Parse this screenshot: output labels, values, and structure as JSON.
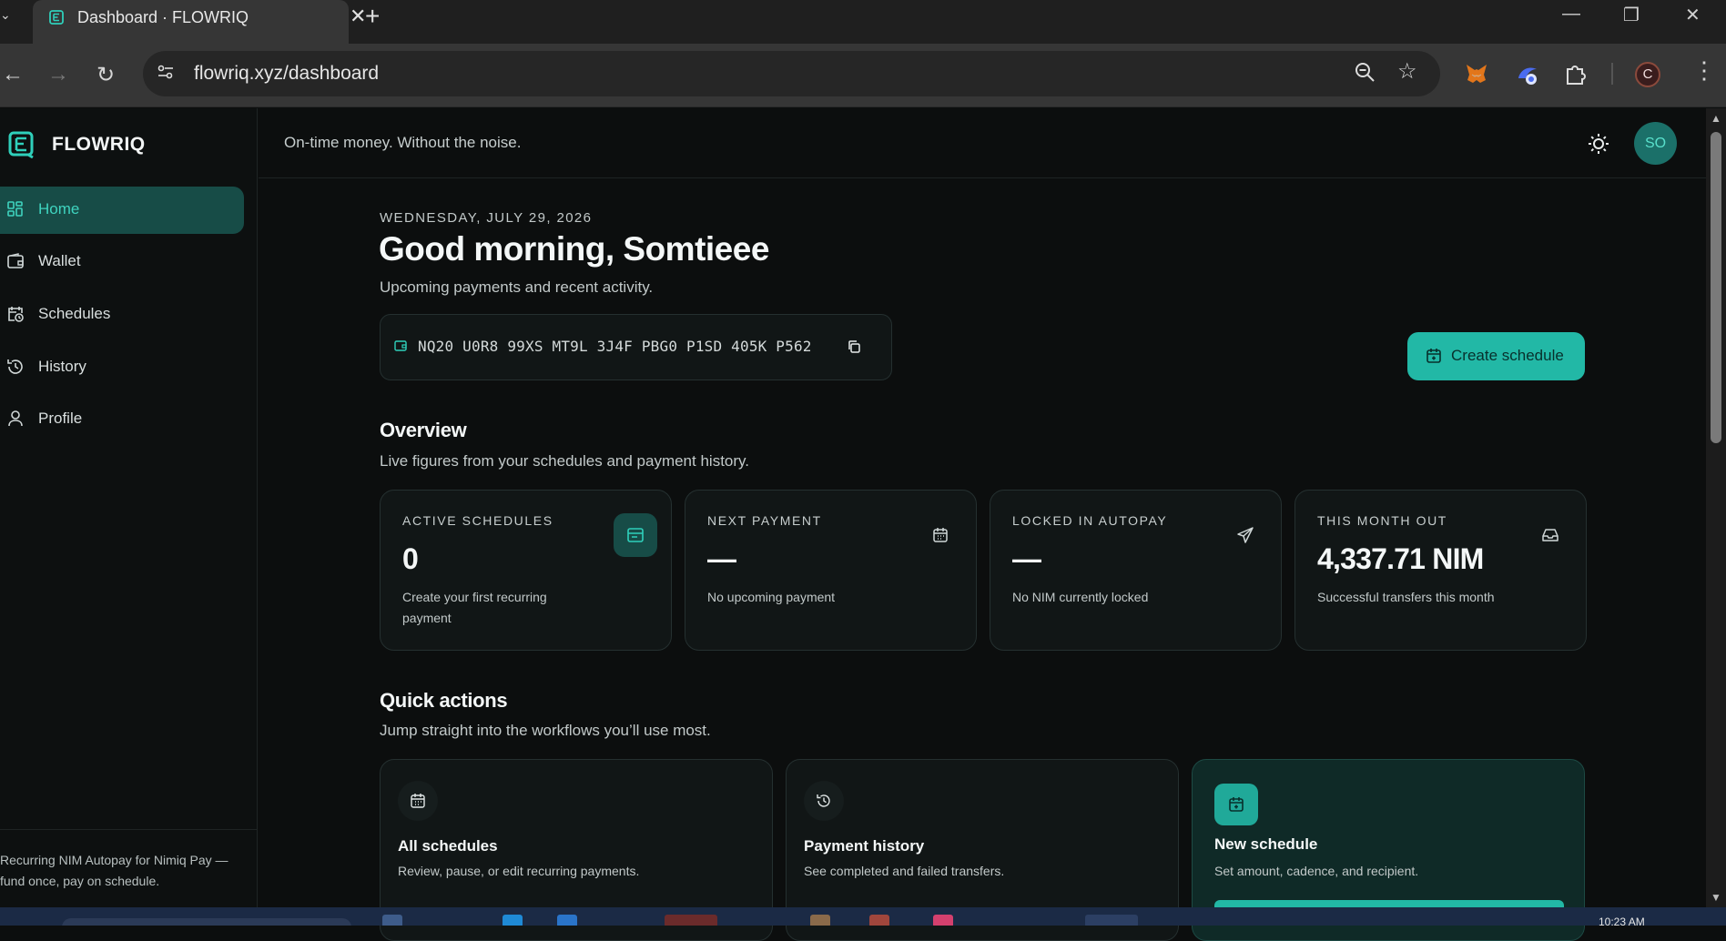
{
  "browser": {
    "tab_title": "Dashboard · FLOWRIQ",
    "url": "flowriq.xyz/dashboard",
    "profile_initial": "C"
  },
  "app": {
    "brand": "FLOWRIQ",
    "tagline": "On-time money. Without the noise.",
    "user_initials": "SO",
    "accent_color": "#22b8a6"
  },
  "sidebar": {
    "items": [
      {
        "label": "Home",
        "icon": "grid-icon",
        "active": true
      },
      {
        "label": "Wallet",
        "icon": "wallet-icon"
      },
      {
        "label": "Schedules",
        "icon": "calendar-clock-icon"
      },
      {
        "label": "History",
        "icon": "history-icon"
      },
      {
        "label": "Profile",
        "icon": "user-icon"
      }
    ],
    "footer_line1": "Recurring NIM Autopay for Nimiq Pay —",
    "footer_line2": "fund once, pay on schedule."
  },
  "header": {
    "date": "WEDNESDAY, JULY 29, 2026",
    "greeting": "Good morning, Somtieee",
    "subtitle": "Upcoming payments and recent activity.",
    "wallet_address": "NQ20 U0R8 99XS MT9L 3J4F PBG0 P1SD 405K P562",
    "create_button": "Create schedule"
  },
  "overview": {
    "title": "Overview",
    "subtitle": "Live figures from your schedules and payment history.",
    "stats": [
      {
        "label": "ACTIVE SCHEDULES",
        "value": "0",
        "desc": "Create your first recurring payment",
        "icon": "card-icon"
      },
      {
        "label": "NEXT PAYMENT",
        "value": "—",
        "desc": "No upcoming payment",
        "icon": "calendar-icon"
      },
      {
        "label": "LOCKED IN AUTOPAY",
        "value": "—",
        "desc": "No NIM currently locked",
        "icon": "send-icon"
      },
      {
        "label": "THIS MONTH OUT",
        "value": "4,337.71 NIM",
        "desc": "Successful transfers this month",
        "icon": "inbox-icon"
      }
    ]
  },
  "quick_actions": {
    "title": "Quick actions",
    "subtitle": "Jump straight into the workflows you’ll use most.",
    "items": [
      {
        "title": "All schedules",
        "desc": "Review, pause, or edit recurring payments.",
        "icon": "calendar-icon"
      },
      {
        "title": "Payment history",
        "desc": "See completed and failed transfers.",
        "icon": "history-icon"
      },
      {
        "title": "New schedule",
        "desc": "Set amount, cadence, and recipient.",
        "icon": "calendar-plus-icon"
      }
    ]
  },
  "taskbar": {
    "clock": "10:23 AM"
  }
}
